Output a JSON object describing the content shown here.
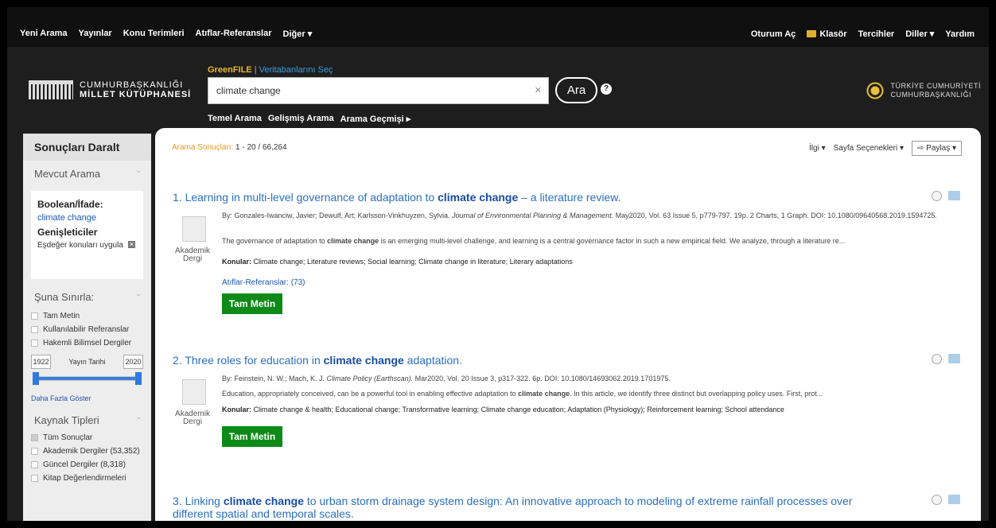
{
  "topnav": {
    "left": [
      "Yeni Arama",
      "Yayınlar",
      "Konu Terimleri",
      "Atıflar-Referanslar",
      "Diğer ▾"
    ],
    "login": "Oturum Aç",
    "folder": "Klasör",
    "prefs": "Tercihler",
    "languages": "Diller ▾",
    "help": "Yardım"
  },
  "logo": {
    "line1": "CUMHURBAŞKANLIĞI",
    "line2": "MİLLET KÜTÜPHANESİ"
  },
  "search": {
    "database": "GreenFILE",
    "choose_db": "Veritabanlarını Seç",
    "query": "climate change",
    "button": "Ara",
    "help": "?",
    "tabs": [
      "Temel Arama",
      "Gelişmiş Arama",
      "Arama Geçmişi ▸"
    ]
  },
  "presidency": {
    "line1": "TÜRKİYE CUMHURİYETİ",
    "line2": "CUMHURBAŞKANLIĞI"
  },
  "sidebar": {
    "title": "Sonuçları Daralt",
    "current_search": "Mevcut Arama",
    "boolean_label": "Boolean/İfade:",
    "boolean_value": "climate change",
    "expanders": "Genişleticiler",
    "expander_item": "Eşdeğer konuları uygula",
    "limit_to": "Şuna Sınırla:",
    "limits": [
      "Tam Metin",
      "Kullanılabilir Referanslar",
      "Hakemli Bilimsel Dergiler"
    ],
    "year_from": "1922",
    "year_label": "Yayın Tarihi",
    "year_to": "2020",
    "show_more": "Daha Fazla Göster",
    "source_types": "Kaynak Tipleri",
    "sources": [
      "Tüm Sonuçlar",
      "Akademik Dergiler (53,352)",
      "Güncel Dergiler (8,318)",
      "Kitap Değerlendirmeleri"
    ]
  },
  "results": {
    "label": "Arama Sonuçları:",
    "range": "1 - 20 / 66,264",
    "sort": "İlgi ▾",
    "page_options": "Sayfa Seçenekleri ▾",
    "share": "⇨ Paylaş ▾",
    "items": [
      {
        "t1": "1. Learning in multi-level governance of adaptation to ",
        "hl": "climate change",
        "t2": " – a literature review.",
        "authors": "By: Gonzales-Iwanciw, Javier; Dewulf, Art; Karlsson-Vinkhuyzen, Sylvia. ",
        "journal": "Journal of Environmental Planning & Management.",
        "meta": " May2020, Vol. 63 Issue 5, p779-797. 19p. 2 Charts, 1 Graph. DOI: 10.1080/09640568.2019.1594725.",
        "abs1": "The governance of adaptation to ",
        "abs_hl": "climate change",
        "abs2": " is an emerging multi-level challenge, and learning is a central governance factor in such a new empirical field. We analyze, through a literature re...",
        "subj_label": "Konular:",
        "subj": " Climate change; Literature reviews; Social learning; Climate change in literature; Literary adaptations",
        "type": "Akademik Dergi",
        "cites": "Atıflar-Referanslar: (73)",
        "fulltext": "Tam Metin"
      },
      {
        "t1": "2. Three roles for education in ",
        "hl": "climate change",
        "t2": " adaptation.",
        "authors": "By: Feinstein, N. W.; Mach, K. J. ",
        "journal": "Climate Policy (Earthscan).",
        "meta": " Mar2020, Vol. 20 Issue 3, p317-322. 6p. DOI: 10.1080/14693062.2019.1701975.",
        "abs1": "Education, appropriately conceived, can be a powerful tool in enabling effective adaptation to ",
        "abs_hl": "climate change",
        "abs2": ". In this article, we identify three distinct but overlapping policy uses. First, prot...",
        "subj_label": "Konular:",
        "subj": " Climate change & health; Educational change; Transformative learning; Climate change education; Adaptation (Physiology); Reinforcement learning; School attendance",
        "type": "Akademik Dergi",
        "fulltext": "Tam Metin"
      },
      {
        "t1": "3. Linking ",
        "hl": "climate change",
        "t2": " to urban storm drainage system design: An innovative approach to modeling of extreme rainfall processes over different spatial and temporal scales."
      }
    ]
  }
}
